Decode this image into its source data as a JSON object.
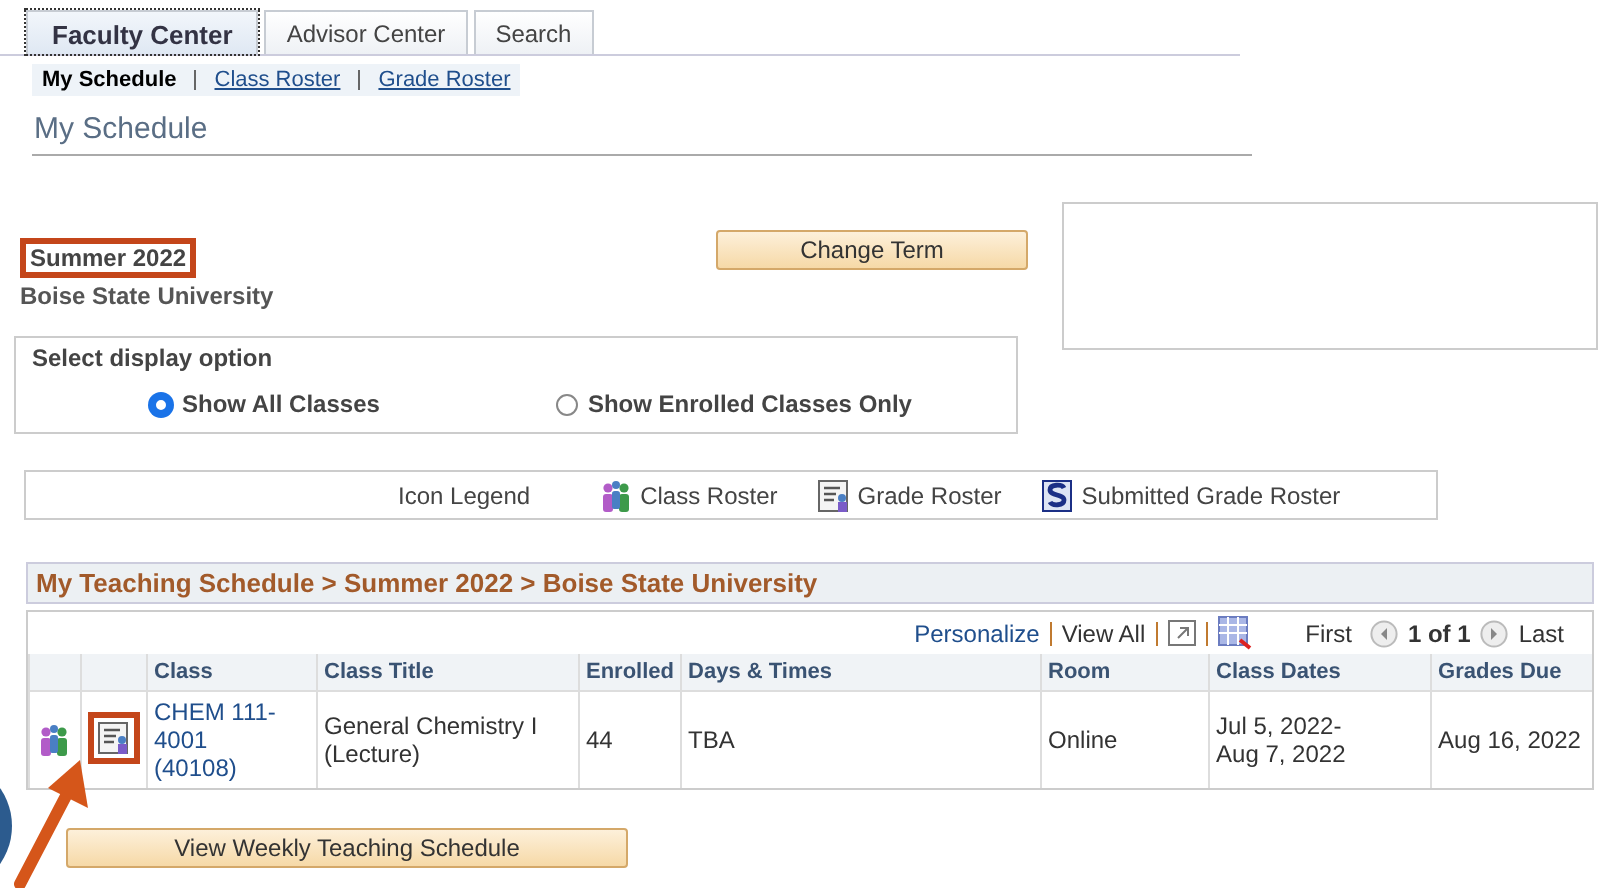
{
  "tabs": [
    {
      "label": "Faculty Center",
      "selected": true
    },
    {
      "label": "Advisor Center",
      "selected": false
    },
    {
      "label": "Search",
      "selected": false
    }
  ],
  "subnav": [
    {
      "label": "My Schedule",
      "selected": true
    },
    {
      "label": "Class Roster",
      "selected": false
    },
    {
      "label": "Grade Roster",
      "selected": false
    }
  ],
  "page_title": "My Schedule",
  "term": {
    "name": "Summer 2022",
    "institution": "Boise State University"
  },
  "change_term_button": "Change Term",
  "display_option": {
    "title": "Select display option",
    "options": [
      {
        "label": "Show All Classes",
        "selected": true
      },
      {
        "label": "Show Enrolled Classes Only",
        "selected": false
      }
    ]
  },
  "icon_legend": {
    "title": "Icon Legend",
    "items": [
      {
        "kind": "class-roster",
        "label": "Class Roster"
      },
      {
        "kind": "grade-roster",
        "label": "Grade Roster"
      },
      {
        "kind": "submitted",
        "label": "Submitted Grade Roster"
      }
    ]
  },
  "teaching_schedule": {
    "title": "My Teaching Schedule > Summer 2022 > Boise State University",
    "toolbar": {
      "personalize": "Personalize",
      "view_all": "View All",
      "first": "First",
      "page": "1 of 1",
      "last": "Last"
    },
    "columns": [
      "Class",
      "Class Title",
      "Enrolled",
      "Days & Times",
      "Room",
      "Class Dates",
      "Grades Due"
    ],
    "rows": [
      {
        "class": "CHEM 111-4001 (40108)",
        "title": "General Chemistry I (Lecture)",
        "enrolled": "44",
        "days_times": "TBA",
        "room": "Online",
        "dates": "Jul 5, 2022-Aug 7, 2022",
        "grades_due": "Aug 16, 2022"
      }
    ]
  },
  "view_weekly_button": "View Weekly Teaching Schedule"
}
